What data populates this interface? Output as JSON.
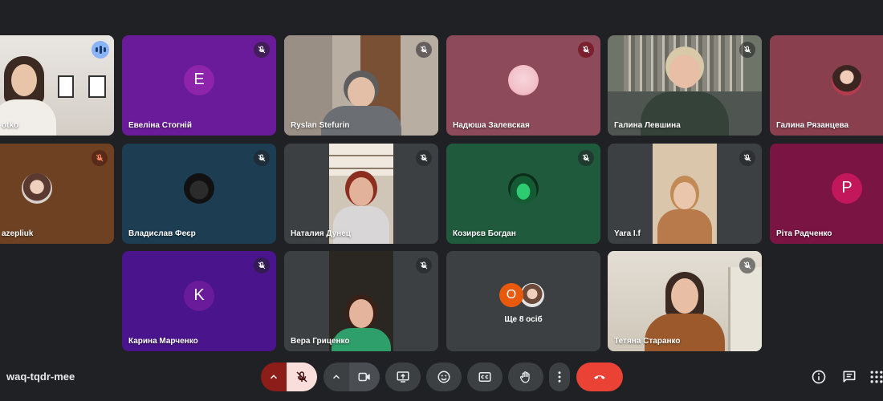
{
  "meeting": {
    "code": "waq-tqdr-mee"
  },
  "tiles": [
    {
      "name": "otko",
      "kind": "camera",
      "speaking": true
    },
    {
      "name": "Евеліна Стогній",
      "kind": "letter",
      "letter": "E",
      "bg": "#6a1b9a",
      "avatar": "#8e24aa"
    },
    {
      "name": "Ryslan Stefurin",
      "kind": "camera"
    },
    {
      "name": "Надюша Залевская",
      "kind": "photo",
      "bg": "#8d4a5a"
    },
    {
      "name": "Галина Левшина",
      "kind": "camera"
    },
    {
      "name": "Галина Рязанцева",
      "kind": "photo",
      "bg": "#8a3f4f"
    },
    {
      "name": "azepliuk",
      "kind": "photo",
      "bg": "#6d4122"
    },
    {
      "name": "Владислав Феєр",
      "kind": "photo",
      "bg": "#1c3d52"
    },
    {
      "name": "Наталия Дунец",
      "kind": "camera"
    },
    {
      "name": "Козирєв Богдан",
      "kind": "photo",
      "bg": "#1f5a3d"
    },
    {
      "name": "Yara I.f",
      "kind": "camera"
    },
    {
      "name": "Ріта Радченко",
      "kind": "letter",
      "letter": "P",
      "bg": "#7a1442",
      "avatar": "#c2185b"
    },
    {
      "name": "Карина Марченко",
      "kind": "letter",
      "letter": "K",
      "bg": "#4a148c",
      "avatar": "#6a1b9a"
    },
    {
      "name": "Вера Гриценко",
      "kind": "camera"
    },
    {
      "name": "Тетяна Старанко",
      "kind": "camera"
    }
  ],
  "others": {
    "label": "Ще 8 осіб",
    "letter": "О"
  },
  "colors": {
    "end_call": "#ea4335",
    "mic_off": "#f9dedc",
    "mic_group": "#8c1d18"
  }
}
